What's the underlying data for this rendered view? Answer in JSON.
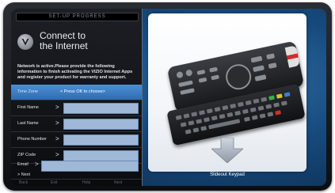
{
  "setup": {
    "progress_label": "SET-UP PROGRESS",
    "title_line1": "Connect to",
    "title_line2": "the Internet",
    "description": "Network is active.Please provide the following information to finish activating the VIZIO Internet Apps and register your product for warranty and support.",
    "rows": [
      {
        "label": "Time Zone",
        "value": "< Press OK to choose>"
      },
      {
        "label": "First Name",
        "value": ""
      },
      {
        "label": "Last Name",
        "value": ""
      },
      {
        "label": "Phone Number",
        "value": ""
      },
      {
        "label": "ZIP Code",
        "value": ""
      },
      {
        "label": "Email",
        "value": ""
      }
    ],
    "next_label": "Next",
    "footer": [
      "Back",
      "Exit",
      "Help",
      "Next"
    ]
  },
  "keypad": {
    "caption": "Slideout Keypad"
  },
  "colors": {
    "highlight": "#3f7fc6",
    "field": "#9fb8d8",
    "screen_bg": "#174a7c"
  },
  "icons": {
    "logo": "vizio-v-logo-icon",
    "arrow": "down-arrow-icon"
  }
}
